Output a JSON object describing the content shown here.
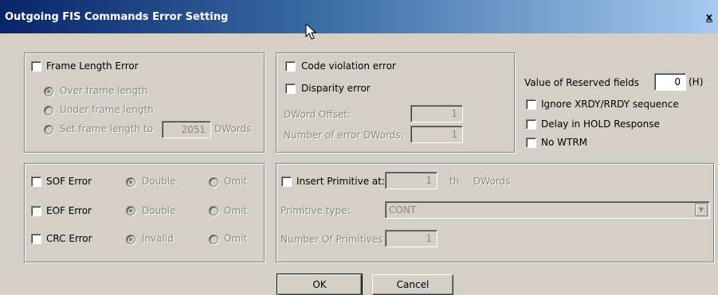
{
  "window": {
    "title": "Outgoing FIS Commands Error Setting",
    "close_label": "x"
  },
  "frame_group": {
    "checkbox_label": "Frame Length Error",
    "options": [
      "Over frame length",
      "Under frame length",
      "Set frame length to"
    ],
    "selected_option": "Over frame length",
    "frame_length_value": "2051",
    "frame_length_unit": "DWords"
  },
  "code_group": {
    "code_violation_label": "Code violation error",
    "disparity_label": "Disparity error",
    "dword_offset_label": "DWord Offset:",
    "dword_offset_value": "1",
    "num_error_dwords_label": "Number of error DWords:",
    "num_error_dwords_value": "1"
  },
  "reserved": {
    "label": "Value of Reserved fields",
    "value": "0",
    "unit": "(H)",
    "ignore_label": "Ignore XRDY/RRDY sequence",
    "delay_label": "Delay  in HOLD Response",
    "no_wtrm_label": "No WTRM"
  },
  "error_group": {
    "rows": [
      {
        "label": "SOF Error",
        "option1": "Double",
        "option2": "Omit"
      },
      {
        "label": "EOF Error",
        "option1": "Double",
        "option2": "Omit"
      },
      {
        "label": "CRC Error",
        "option1": "Invalid",
        "option2": "Omit"
      }
    ]
  },
  "primitive_group": {
    "insert_label": "Insert Primitive at:",
    "insert_value": "1",
    "th_label": "th",
    "dwords_label": "DWords",
    "type_label": "Primitive type:",
    "type_value": "CONT",
    "count_label": "Number Of Primitives",
    "count_value": "1"
  },
  "buttons": {
    "ok": "OK",
    "cancel": "Cancel"
  },
  "colors": {
    "title_start": "#0a246a",
    "title_end": "#a6caf0",
    "face": "#d4d0c8",
    "disabled_text": "#8a8780"
  },
  "icons": {
    "cursor": "arrow-cursor-icon",
    "close": "close-icon"
  }
}
